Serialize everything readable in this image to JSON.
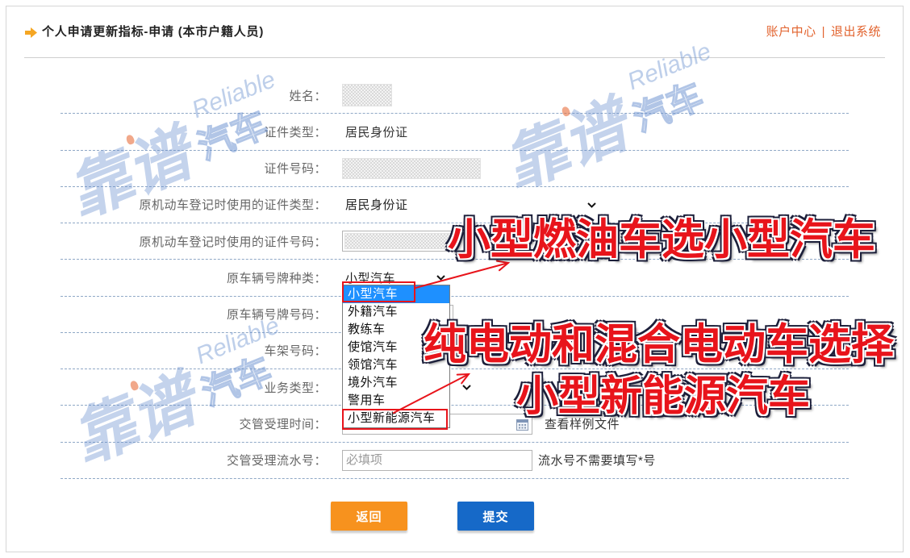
{
  "header": {
    "title": "个人申请更新指标-申请 (本市户籍人员)",
    "account_link": "账户中心",
    "separator": "|",
    "logout_link": "退出系统"
  },
  "form": {
    "name": {
      "label": "姓名："
    },
    "id_type": {
      "label": "证件类型：",
      "value": "居民身份证"
    },
    "id_number": {
      "label": "证件号码："
    },
    "orig_id_type": {
      "label": "原机动车登记时使用的证件类型：",
      "value": "居民身份证"
    },
    "orig_id_number": {
      "label": "原机动车登记时使用的证件号码："
    },
    "plate_type": {
      "label": "原车辆号牌种类：",
      "value": "小型汽车",
      "options": [
        "小型汽车",
        "外籍汽车",
        "教练车",
        "使馆汽车",
        "领馆汽车",
        "境外汽车",
        "警用车",
        "小型新能源汽车"
      ],
      "highlighted_index": 0
    },
    "plate_number": {
      "label": "原车辆号牌号码："
    },
    "vin": {
      "label": "车架号码："
    },
    "business_type": {
      "label": "业务类型："
    },
    "accept_time": {
      "label": "交管受理时间：",
      "sample_link": "查看样例文件"
    },
    "serial_no": {
      "label": "交管受理流水号：",
      "placeholder": "必填项",
      "hint": "流水号不需要填写*号"
    }
  },
  "buttons": {
    "back": "返回",
    "submit": "提交"
  },
  "annotations": {
    "fuel_car_note": "小型燃油车选小型汽车",
    "ev_note_line1": "纯电动和混合电动车选择",
    "ev_note_line2": "小型新能源汽车"
  },
  "watermark": {
    "brand_cn": "靠谱",
    "brand_en": "Reliable",
    "brand_tail": "汽车"
  },
  "colors": {
    "accent_orange": "#f7921e",
    "submit_blue": "#1669c8",
    "link": "#e2632e",
    "annotation_red": "#e8141b",
    "highlight_blue": "#1e90ff"
  }
}
